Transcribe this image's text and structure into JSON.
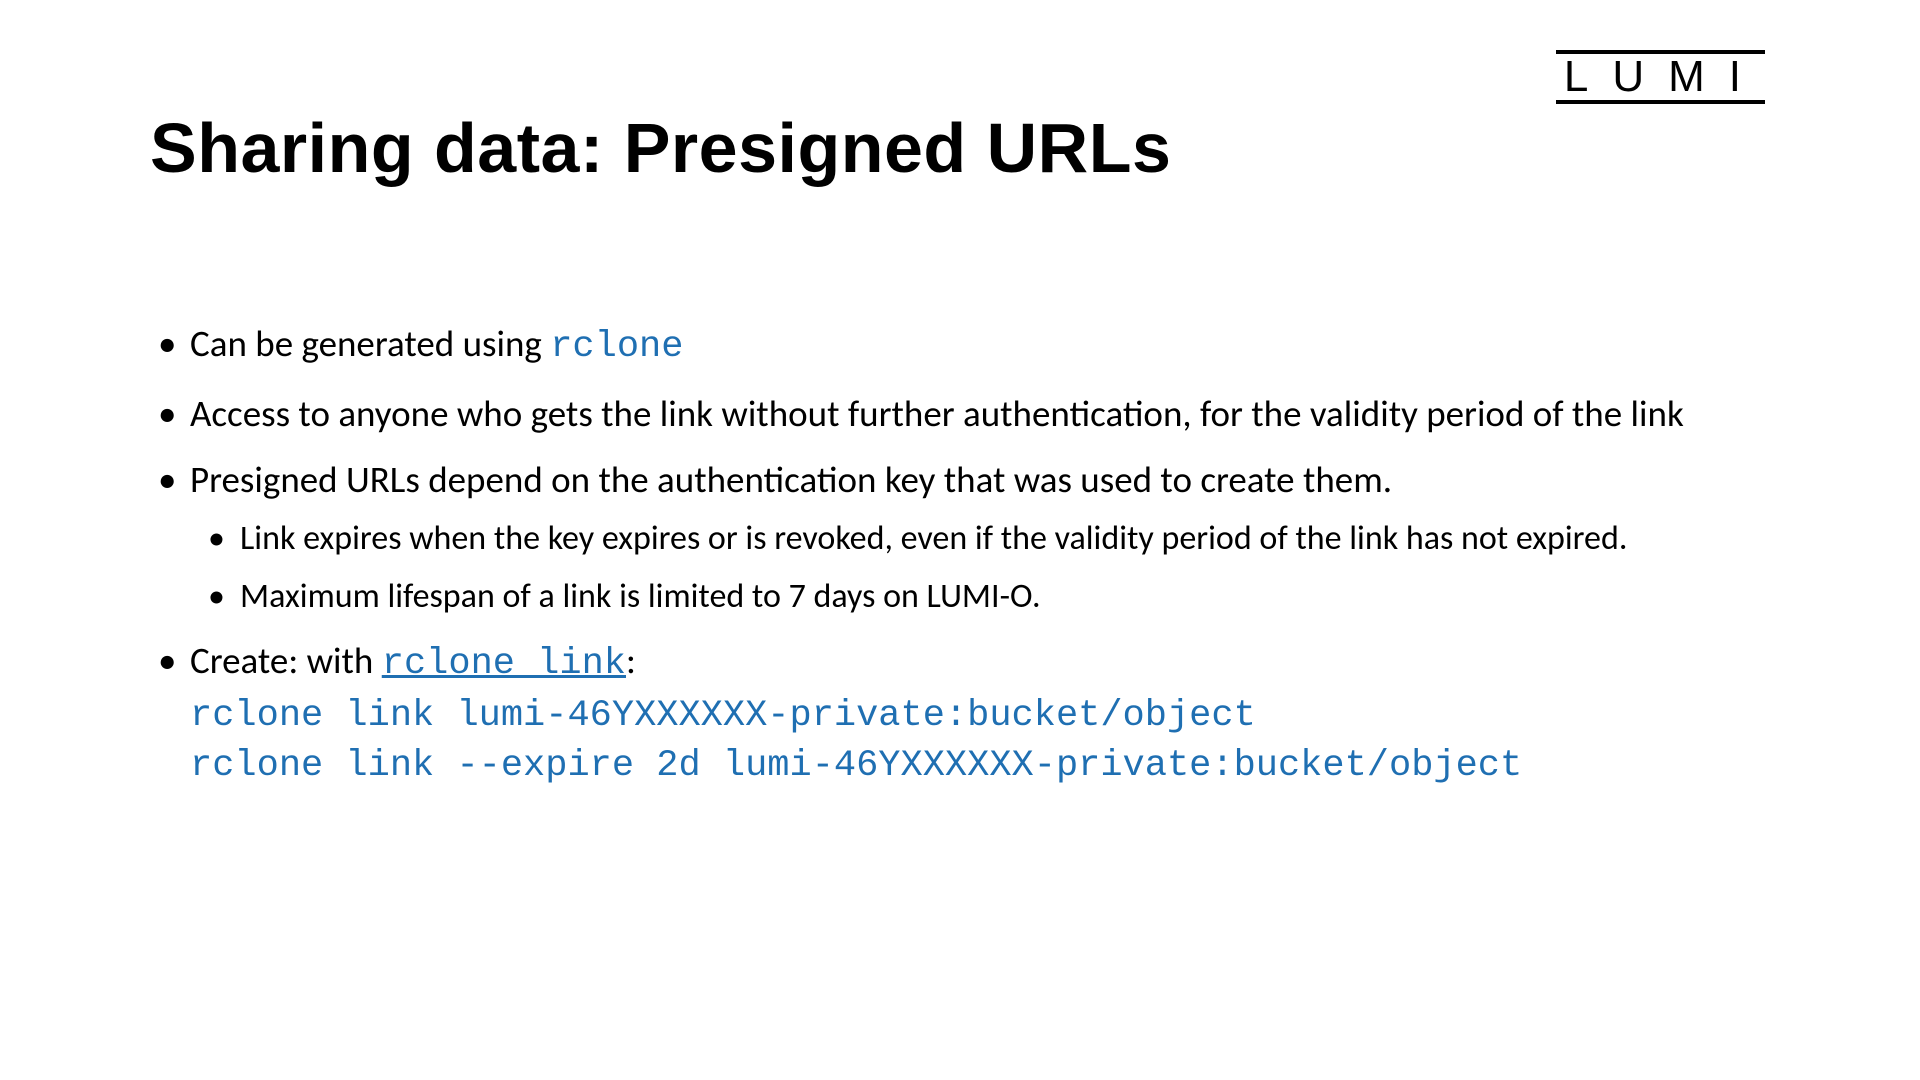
{
  "logo": "LUMI",
  "title": "Sharing data: Presigned URLs",
  "bullets": {
    "b1_pre": "Can be generated using ",
    "b1_code": "rclone",
    "b2": "Access to anyone who gets the link without further authentication, for the validity period of the link",
    "b3": "Presigned URLs depend on the authentication key that was used to create them.",
    "b3_sub1": "Link expires when the key expires or is revoked, even if the validity period of the link has not expired.",
    "b3_sub2": "Maximum lifespan of a link is limited to 7 days on LUMI-O.",
    "b4_pre": "Create: with ",
    "b4_link": "rclone link",
    "b4_post": ":",
    "cmd1": "rclone link lumi-46YXXXXXX-private:bucket/object",
    "cmd2": "rclone link --expire 2d lumi-46YXXXXXX-private:bucket/object"
  },
  "colors": {
    "code": "#1f6fb2",
    "text": "#000000"
  }
}
